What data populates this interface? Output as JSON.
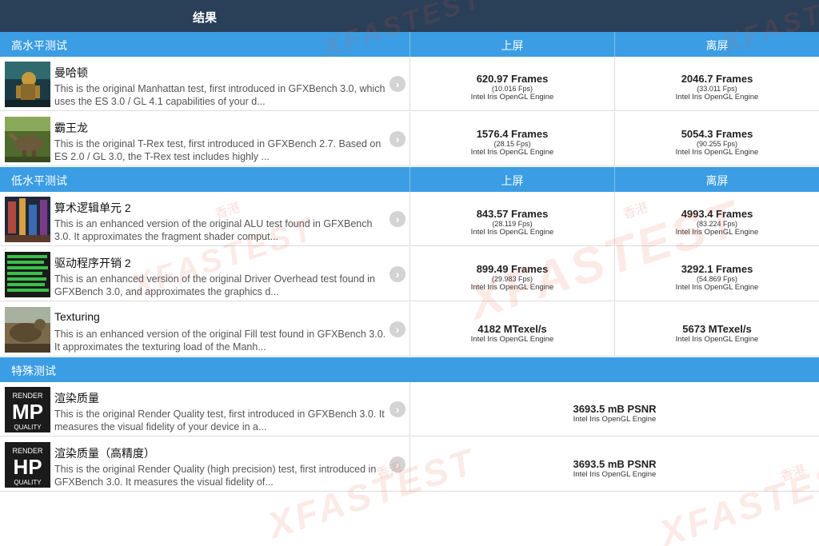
{
  "header": {
    "title": "结果"
  },
  "columns": {
    "onscreen": "上屏",
    "offscreen": "离屏"
  },
  "sections": {
    "high": {
      "title": "高水平测试",
      "tests": [
        {
          "name": "曼哈顿",
          "desc": "This is the original Manhattan test, first introduced in GFXBench 3.0, which uses the ES 3.0 / GL 4.1 capabilities of your d...",
          "onscreen": {
            "value": "620.97 Frames",
            "fps": "(10.016 Fps)",
            "engine": "Intel Iris OpenGL Engine"
          },
          "offscreen": {
            "value": "2046.7 Frames",
            "fps": "(33.011 Fps)",
            "engine": "Intel Iris OpenGL Engine"
          }
        },
        {
          "name": "霸王龙",
          "desc": "This is the original T-Rex test, first introduced in GFXBench 2.7. Based on ES 2.0 / GL 3.0, the T-Rex test includes highly ...",
          "onscreen": {
            "value": "1576.4 Frames",
            "fps": "(28.15 Fps)",
            "engine": "Intel Iris OpenGL Engine"
          },
          "offscreen": {
            "value": "5054.3 Frames",
            "fps": "(90.255 Fps)",
            "engine": "Intel Iris OpenGL Engine"
          }
        }
      ]
    },
    "low": {
      "title": "低水平测试",
      "tests": [
        {
          "name": "算术逻辑单元 2",
          "desc": "This is an enhanced version of the original ALU test found in GFXBench 3.0. It approximates the fragment shader comput...",
          "onscreen": {
            "value": "843.57 Frames",
            "fps": "(28.119 Fps)",
            "engine": "Intel Iris OpenGL Engine"
          },
          "offscreen": {
            "value": "4993.4 Frames",
            "fps": "(83.224 Fps)",
            "engine": "Intel Iris OpenGL Engine"
          }
        },
        {
          "name": "驱动程序开销 2",
          "desc": "This is an enhanced version of the original Driver Overhead test found in GFXBench 3.0, and approximates the graphics d...",
          "onscreen": {
            "value": "899.49 Frames",
            "fps": "(29.983 Fps)",
            "engine": "Intel Iris OpenGL Engine"
          },
          "offscreen": {
            "value": "3292.1 Frames",
            "fps": "(54.869 Fps)",
            "engine": "Intel Iris OpenGL Engine"
          }
        },
        {
          "name": "Texturing",
          "desc": "This is an enhanced version of the original Fill test found in GFXBench 3.0. It approximates the texturing load of the Manh...",
          "onscreen": {
            "value": "4182 MTexel/s",
            "engine": "Intel Iris OpenGL Engine"
          },
          "offscreen": {
            "value": "5673 MTexel/s",
            "engine": "Intel Iris OpenGL Engine"
          }
        }
      ]
    },
    "special": {
      "title": "特殊测试",
      "tests": [
        {
          "name": "渲染质量",
          "icon": {
            "top": "RENDER",
            "mid": "MP",
            "bottom": "QUALITY"
          },
          "desc": "This is the original Render Quality test, first introduced in GFXBench 3.0. It measures the visual fidelity of your device in a...",
          "result": {
            "value": "3693.5 mB PSNR",
            "engine": "Intel Iris OpenGL Engine"
          }
        },
        {
          "name": "渲染质量（高精度）",
          "icon": {
            "top": "RENDER",
            "mid": "HP",
            "bottom": "QUALITY"
          },
          "desc": "This is the original Render Quality (high precision) test, first introduced in GFXBench 3.0. It measures the visual fidelity of...",
          "result": {
            "value": "3693.5 mB PSNR",
            "engine": "Intel Iris OpenGL Engine"
          }
        }
      ]
    }
  },
  "chevron_glyph": "›",
  "watermark": {
    "brand": "XFASTEST",
    "small": "香港"
  },
  "colors": {
    "topbar": "#2a3f58",
    "section": "#3b9de3",
    "chevron": "#d3d3d3"
  }
}
